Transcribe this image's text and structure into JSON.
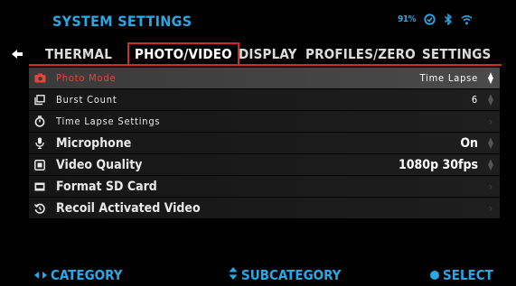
{
  "header": {
    "title": "SYSTEM SETTINGS",
    "battery_text": "91%",
    "status_icons": [
      "stabilizer-icon",
      "bluetooth-icon",
      "wifi-icon"
    ]
  },
  "tabs": [
    {
      "label": "THERMAL",
      "active": false
    },
    {
      "label": "PHOTO/VIDEO",
      "active": true
    },
    {
      "label": "DISPLAY",
      "active": false
    },
    {
      "label": "PROFILES/ZERO",
      "active": false
    },
    {
      "label": "SETTINGS",
      "active": false
    }
  ],
  "rows": [
    {
      "icon": "camera-icon",
      "label": "Photo Mode",
      "value": "Time Lapse",
      "control": "up-down",
      "selected": true
    },
    {
      "icon": "burst-icon",
      "label": "Burst Count",
      "value": "6",
      "control": "up-down",
      "selected": false
    },
    {
      "icon": "timer-icon",
      "label": "Time Lapse Settings",
      "value": "",
      "control": "chevron",
      "selected": false
    },
    {
      "icon": "microphone-icon",
      "label": "Microphone",
      "value": "On",
      "control": "up-down",
      "selected": false
    },
    {
      "icon": "video-quality-icon",
      "label": "Video Quality",
      "value": "1080p 30fps",
      "control": "up-down",
      "selected": false
    },
    {
      "icon": "sd-card-icon",
      "label": "Format SD Card",
      "value": "",
      "control": "chevron",
      "selected": false
    },
    {
      "icon": "recoil-icon",
      "label": "Recoil Activated Video",
      "value": "",
      "control": "chevron",
      "selected": false
    }
  ],
  "footer": {
    "category": "CATEGORY",
    "subcategory": "SUBCATEGORY",
    "select": "SELECT"
  },
  "colors": {
    "accent": "#2aa7e3",
    "selected_text": "#e5443a",
    "tab_outline": "#c8312b"
  }
}
